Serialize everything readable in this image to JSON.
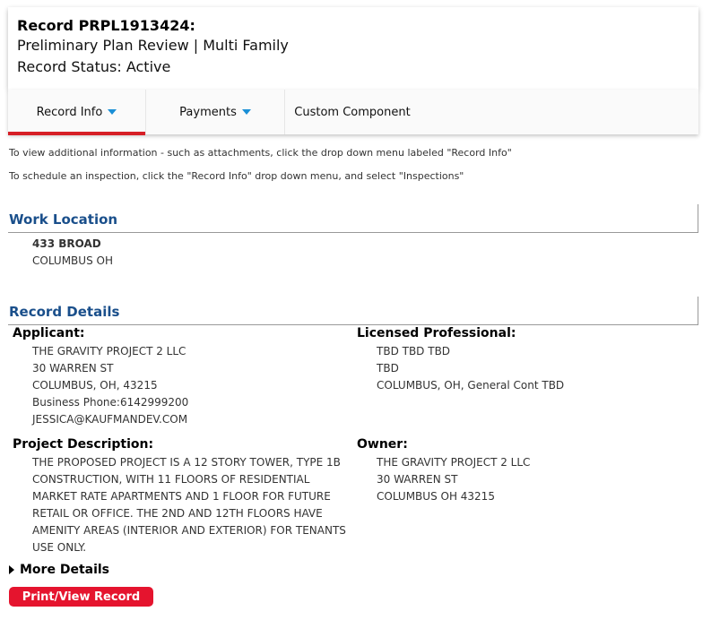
{
  "record": {
    "title": "Record PRPL1913424:",
    "type": "Preliminary Plan Review | Multi Family",
    "status": "Record Status: Active"
  },
  "tabs": [
    {
      "label": "Record Info",
      "dropdown": true,
      "active": true
    },
    {
      "label": "Payments",
      "dropdown": true,
      "active": false
    },
    {
      "label": "Custom Component",
      "dropdown": false,
      "active": false
    }
  ],
  "info": {
    "line1": "To view additional information - such as attachments, click the drop down menu labeled \"Record Info\"",
    "line2": "To schedule an inspection, click the \"Record Info\" drop down menu, and select \"Inspections\""
  },
  "work_location": {
    "heading": "Work Location",
    "address1": "433 BROAD",
    "address2": "COLUMBUS OH"
  },
  "record_details": {
    "heading": "Record Details",
    "applicant": {
      "label": "Applicant:",
      "name": "THE GRAVITY PROJECT 2 LLC",
      "street": "30 WARREN ST",
      "city": "COLUMBUS, OH, 43215",
      "phone_label": "Business Phone:",
      "phone": "6142999200",
      "email": "JESSICA@KAUFMANDEV.COM"
    },
    "licensed_professional": {
      "label": "Licensed Professional:",
      "line1": "TBD TBD TBD",
      "line2": "TBD",
      "line3": "COLUMBUS, OH, General Cont TBD"
    },
    "project_description": {
      "label": "Project Description:",
      "lines": [
        "THE PROPOSED PROJECT IS A 12 STORY TOWER, TYPE 1B",
        "CONSTRUCTION, WITH 11 FLOORS OF RESIDENTIAL",
        "MARKET RATE APARTMENTS AND 1 FLOOR FOR FUTURE",
        "RETAIL OR OFFICE. THE 2ND AND 12TH FLOORS HAVE",
        "AMENITY AREAS (INTERIOR AND EXTERIOR) FOR TENANTS",
        "USE ONLY."
      ]
    },
    "owner": {
      "label": "Owner:",
      "line1": "THE GRAVITY PROJECT 2 LLC",
      "line2": "30 WARREN ST",
      "line3": "COLUMBUS OH 43215"
    }
  },
  "more_details": "More Details",
  "print_button": "Print/View Record",
  "colors": {
    "accent_red": "#d61f26",
    "button_red": "#e5142e",
    "heading_blue": "#1a4f8b",
    "caret_blue": "#1a8fd6"
  }
}
